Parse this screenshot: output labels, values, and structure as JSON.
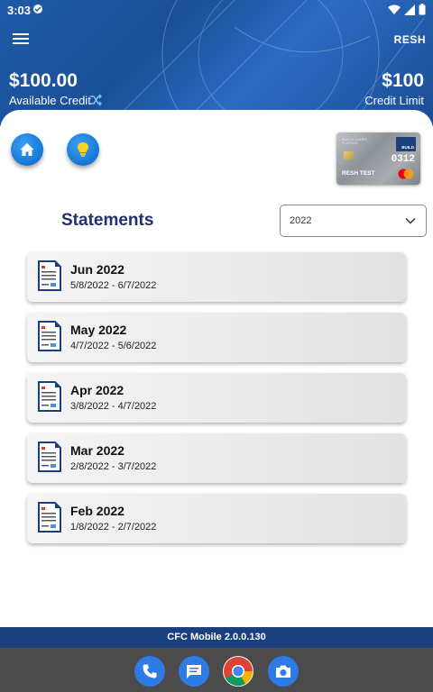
{
  "status_bar": {
    "time": "3:03"
  },
  "header": {
    "user_name": "RESH",
    "available_amount": "$100.00",
    "available_label": "Available Credit",
    "limit_amount": "$100",
    "limit_label": "Credit Limit"
  },
  "card": {
    "brand": "BUILD CARD",
    "brand_sub": "PLATINUM",
    "badge": "BUILD",
    "last_four": "0312",
    "holder": "RESH TEST"
  },
  "statements": {
    "title": "Statements",
    "year_selected": "2022",
    "items": [
      {
        "month": "Jun 2022",
        "range": "5/8/2022 - 6/7/2022"
      },
      {
        "month": "May 2022",
        "range": "4/7/2022 - 5/6/2022"
      },
      {
        "month": "Apr 2022",
        "range": "3/8/2022 - 4/7/2022"
      },
      {
        "month": "Mar 2022",
        "range": "2/8/2022 - 3/7/2022"
      },
      {
        "month": "Feb 2022",
        "range": "1/8/2022 - 2/7/2022"
      }
    ]
  },
  "footer": {
    "version": "CFC Mobile 2.0.0.130"
  },
  "colors": {
    "header_blue": "#1f5aa8",
    "title_navy": "#1f3170",
    "footer_navy": "#1a3f7e",
    "button_blue": "#1577d6"
  },
  "icons": {
    "menu": "hamburger-icon",
    "shuffle": "shuffle-icon",
    "home": "home-icon",
    "tip": "lightbulb-icon",
    "dropdown": "chevron-down-icon",
    "statement": "document-icon"
  }
}
